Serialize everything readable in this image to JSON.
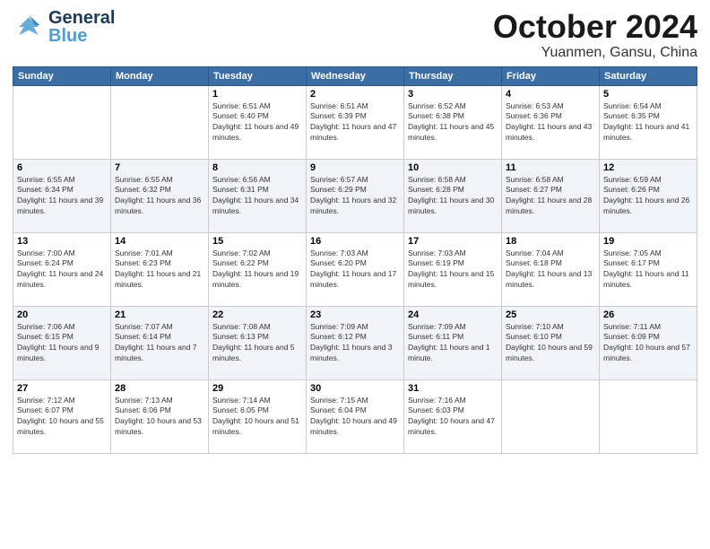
{
  "header": {
    "logo_general": "General",
    "logo_blue": "Blue",
    "month_title": "October 2024",
    "location": "Yuanmen, Gansu, China"
  },
  "days_of_week": [
    "Sunday",
    "Monday",
    "Tuesday",
    "Wednesday",
    "Thursday",
    "Friday",
    "Saturday"
  ],
  "weeks": [
    [
      {
        "day": "",
        "info": ""
      },
      {
        "day": "",
        "info": ""
      },
      {
        "day": "1",
        "info": "Sunrise: 6:51 AM\nSunset: 6:40 PM\nDaylight: 11 hours and 49 minutes."
      },
      {
        "day": "2",
        "info": "Sunrise: 6:51 AM\nSunset: 6:39 PM\nDaylight: 11 hours and 47 minutes."
      },
      {
        "day": "3",
        "info": "Sunrise: 6:52 AM\nSunset: 6:38 PM\nDaylight: 11 hours and 45 minutes."
      },
      {
        "day": "4",
        "info": "Sunrise: 6:53 AM\nSunset: 6:36 PM\nDaylight: 11 hours and 43 minutes."
      },
      {
        "day": "5",
        "info": "Sunrise: 6:54 AM\nSunset: 6:35 PM\nDaylight: 11 hours and 41 minutes."
      }
    ],
    [
      {
        "day": "6",
        "info": "Sunrise: 6:55 AM\nSunset: 6:34 PM\nDaylight: 11 hours and 39 minutes."
      },
      {
        "day": "7",
        "info": "Sunrise: 6:55 AM\nSunset: 6:32 PM\nDaylight: 11 hours and 36 minutes."
      },
      {
        "day": "8",
        "info": "Sunrise: 6:56 AM\nSunset: 6:31 PM\nDaylight: 11 hours and 34 minutes."
      },
      {
        "day": "9",
        "info": "Sunrise: 6:57 AM\nSunset: 6:29 PM\nDaylight: 11 hours and 32 minutes."
      },
      {
        "day": "10",
        "info": "Sunrise: 6:58 AM\nSunset: 6:28 PM\nDaylight: 11 hours and 30 minutes."
      },
      {
        "day": "11",
        "info": "Sunrise: 6:58 AM\nSunset: 6:27 PM\nDaylight: 11 hours and 28 minutes."
      },
      {
        "day": "12",
        "info": "Sunrise: 6:59 AM\nSunset: 6:26 PM\nDaylight: 11 hours and 26 minutes."
      }
    ],
    [
      {
        "day": "13",
        "info": "Sunrise: 7:00 AM\nSunset: 6:24 PM\nDaylight: 11 hours and 24 minutes."
      },
      {
        "day": "14",
        "info": "Sunrise: 7:01 AM\nSunset: 6:23 PM\nDaylight: 11 hours and 21 minutes."
      },
      {
        "day": "15",
        "info": "Sunrise: 7:02 AM\nSunset: 6:22 PM\nDaylight: 11 hours and 19 minutes."
      },
      {
        "day": "16",
        "info": "Sunrise: 7:03 AM\nSunset: 6:20 PM\nDaylight: 11 hours and 17 minutes."
      },
      {
        "day": "17",
        "info": "Sunrise: 7:03 AM\nSunset: 6:19 PM\nDaylight: 11 hours and 15 minutes."
      },
      {
        "day": "18",
        "info": "Sunrise: 7:04 AM\nSunset: 6:18 PM\nDaylight: 11 hours and 13 minutes."
      },
      {
        "day": "19",
        "info": "Sunrise: 7:05 AM\nSunset: 6:17 PM\nDaylight: 11 hours and 11 minutes."
      }
    ],
    [
      {
        "day": "20",
        "info": "Sunrise: 7:06 AM\nSunset: 6:15 PM\nDaylight: 11 hours and 9 minutes."
      },
      {
        "day": "21",
        "info": "Sunrise: 7:07 AM\nSunset: 6:14 PM\nDaylight: 11 hours and 7 minutes."
      },
      {
        "day": "22",
        "info": "Sunrise: 7:08 AM\nSunset: 6:13 PM\nDaylight: 11 hours and 5 minutes."
      },
      {
        "day": "23",
        "info": "Sunrise: 7:09 AM\nSunset: 6:12 PM\nDaylight: 11 hours and 3 minutes."
      },
      {
        "day": "24",
        "info": "Sunrise: 7:09 AM\nSunset: 6:11 PM\nDaylight: 11 hours and 1 minute."
      },
      {
        "day": "25",
        "info": "Sunrise: 7:10 AM\nSunset: 6:10 PM\nDaylight: 10 hours and 59 minutes."
      },
      {
        "day": "26",
        "info": "Sunrise: 7:11 AM\nSunset: 6:09 PM\nDaylight: 10 hours and 57 minutes."
      }
    ],
    [
      {
        "day": "27",
        "info": "Sunrise: 7:12 AM\nSunset: 6:07 PM\nDaylight: 10 hours and 55 minutes."
      },
      {
        "day": "28",
        "info": "Sunrise: 7:13 AM\nSunset: 6:06 PM\nDaylight: 10 hours and 53 minutes."
      },
      {
        "day": "29",
        "info": "Sunrise: 7:14 AM\nSunset: 6:05 PM\nDaylight: 10 hours and 51 minutes."
      },
      {
        "day": "30",
        "info": "Sunrise: 7:15 AM\nSunset: 6:04 PM\nDaylight: 10 hours and 49 minutes."
      },
      {
        "day": "31",
        "info": "Sunrise: 7:16 AM\nSunset: 6:03 PM\nDaylight: 10 hours and 47 minutes."
      },
      {
        "day": "",
        "info": ""
      },
      {
        "day": "",
        "info": ""
      }
    ]
  ]
}
